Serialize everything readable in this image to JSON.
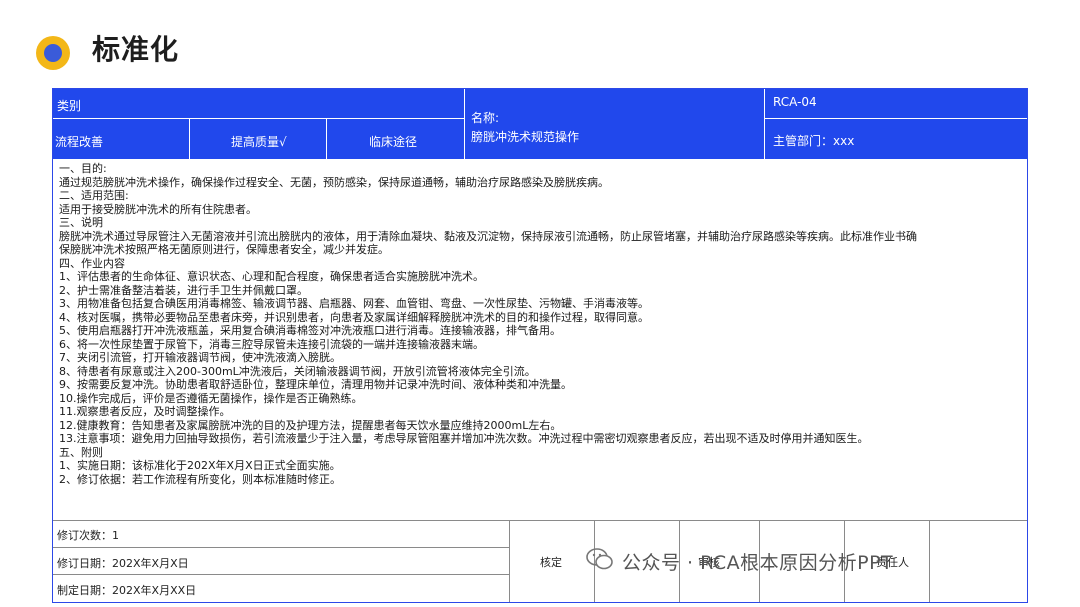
{
  "page": {
    "title": "标准化"
  },
  "header": {
    "category_label": "类别",
    "categories": [
      "流程改善",
      "提高质量√",
      "临床途径"
    ],
    "name_label": "名称:",
    "name_value": "膀胱冲洗术规范操作",
    "code": "RCA-04",
    "dept": "主管部门：xxx"
  },
  "content_lines": [
    "一、目的:",
    "通过规范膀胱冲洗术操作，确保操作过程安全、无菌，预防感染，保持尿道通畅，辅助治疗尿路感染及膀胱疾病。",
    "二、适用范围:",
    "适用于接受膀胱冲洗术的所有住院患者。",
    "三、说明",
    "膀胱冲洗术通过导尿管注入无菌溶液并引流出膀胱内的液体，用于清除血凝块、黏液及沉淀物，保持尿液引流通畅，防止尿管堵塞，并辅助治疗尿路感染等疾病。此标准作业书确",
    "保膀胱冲洗术按照严格无菌原则进行，保障患者安全，减少并发症。",
    "四、作业内容",
    "1、评估患者的生命体征、意识状态、心理和配合程度，确保患者适合实施膀胱冲洗术。",
    "2、护士需准备整洁着装，进行手卫生并佩戴口罩。",
    "3、用物准备包括复合碘医用消毒棉签、输液调节器、启瓶器、网套、血管钳、弯盘、一次性尿垫、污物罐、手消毒液等。",
    "4、核对医嘱，携带必要物品至患者床旁，并识别患者，向患者及家属详细解释膀胱冲洗术的目的和操作过程，取得同意。",
    "5、使用启瓶器打开冲洗液瓶盖，采用复合碘消毒棉签对冲洗液瓶口进行消毒。连接输液器，排气备用。",
    "6、将一次性尿垫置于尿管下，消毒三腔导尿管未连接引流袋的一端并连接输液器末端。",
    "7、夹闭引流管，打开输液器调节阀，使冲洗液滴入膀胱。",
    "8、待患者有尿意或注入200-300mL冲洗液后，关闭输液器调节阀，开放引流管将液体完全引流。",
    "9、按需要反复冲洗。协助患者取舒适卧位，整理床单位，清理用物并记录冲洗时间、液体种类和冲洗量。",
    "10.操作完成后，评价是否遵循无菌操作，操作是否正确熟练。",
    "11.观察患者反应，及时调整操作。",
    "12.健康教育：告知患者及家属膀胱冲洗的目的及护理方法，提醒患者每天饮水量应维持2000mL左右。",
    "13.注意事项：避免用力回抽导致损伤，若引流液量少于注入量，考虑导尿管阻塞并增加冲洗次数。冲洗过程中需密切观察患者反应，若出现不适及时停用并通知医生。",
    "五、附则",
    "1、实施日期：该标准化于202X年X月X日正式全面实施。",
    "2、修订依据：若工作流程有所变化，则本标准随时修正。"
  ],
  "footer": {
    "revision": "修订次数：1",
    "revised_date": "修订日期：202X年X月X日",
    "created_date": "制定日期：202X年X月XX日",
    "approve": "核定",
    "review": "审核",
    "owner": "责任人"
  },
  "watermark": "公众号 · RCA根本原因分析PPT",
  "colors": {
    "header_blue": "#2148ec",
    "bullet_outer": "#f3b718",
    "bullet_inner": "#3a5bd9"
  }
}
